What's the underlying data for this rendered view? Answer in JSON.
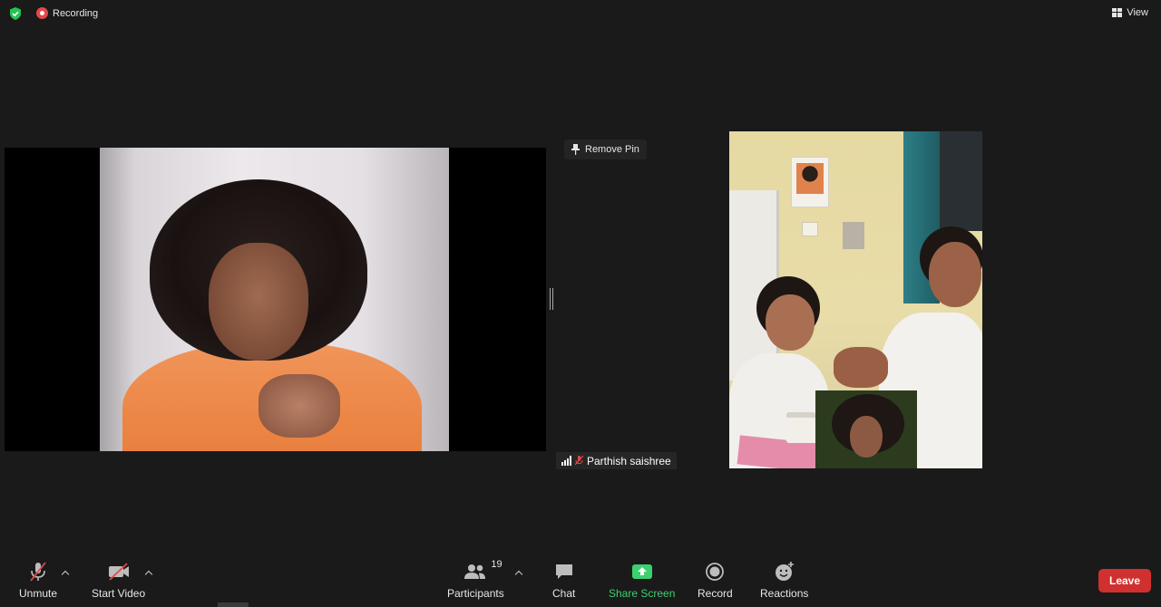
{
  "top_bar": {
    "recording_label": "Recording",
    "view_label": "View"
  },
  "meeting": {
    "remove_pin_label": "Remove Pin",
    "participant_name": "Parthish saishree",
    "participant_muted": true
  },
  "toolbar": {
    "unmute_label": "Unmute",
    "start_video_label": "Start Video",
    "participants_label": "Participants",
    "participants_count": "19",
    "chat_label": "Chat",
    "share_screen_label": "Share Screen",
    "record_label": "Record",
    "reactions_label": "Reactions",
    "leave_label": "Leave"
  },
  "colors": {
    "background": "#1a1a1a",
    "share_green": "#3bd16f",
    "leave_red": "#d03030",
    "recording_red": "#e54848",
    "security_green": "#23c552"
  }
}
